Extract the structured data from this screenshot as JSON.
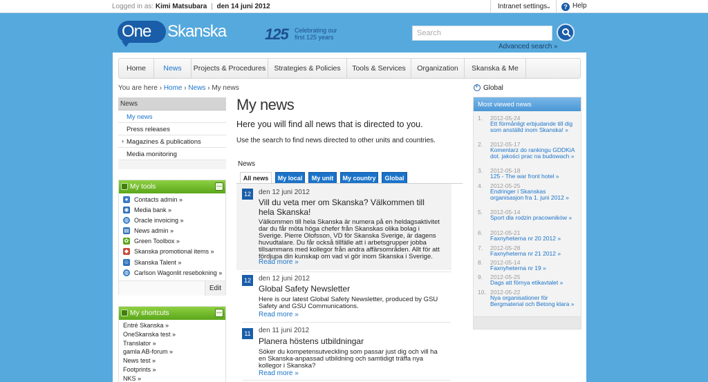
{
  "topbar": {
    "logged_in_label": "Logged in as:",
    "user": "Kimi Matsubara",
    "separator": "|",
    "date": "den 14 juni 2012",
    "intranet_settings": "Intranet settings",
    "help": "Help"
  },
  "header": {
    "logo_one": "One",
    "logo_skanska": "Skanska",
    "anniversary_number": "125",
    "anniversary_text": "Celebrating our first 125 years",
    "search_placeholder": "Search",
    "advanced_search": "Advanced search »"
  },
  "nav": {
    "items": [
      {
        "label": "Home"
      },
      {
        "label": "News"
      },
      {
        "label": "Projects & Procedures"
      },
      {
        "label": "Strategies & Policies"
      },
      {
        "label": "Tools & Services"
      },
      {
        "label": "Organization"
      },
      {
        "label": "Skanska & Me"
      }
    ],
    "active_index": 1
  },
  "breadcrumb": {
    "you_are_here": "You are here",
    "sep": "›",
    "home": "Home",
    "news": "News",
    "current": "My news"
  },
  "leftnav": {
    "header": "News",
    "items": [
      {
        "label": "My news"
      },
      {
        "label": "Press releases"
      },
      {
        "label": "Magazines & publications"
      },
      {
        "label": "Media monitoring"
      }
    ]
  },
  "mytools": {
    "title": "My tools",
    "items": [
      {
        "label": "Contacts admin »",
        "icon": "contacts-icon",
        "color": "#3a7bc8"
      },
      {
        "label": "Media bank »",
        "icon": "media-icon",
        "color": "#2d6db5"
      },
      {
        "label": "Oracle invoicing »",
        "icon": "globe-icon",
        "color": "#2f78c4"
      },
      {
        "label": "News admin »",
        "icon": "news-icon",
        "color": "#2b6fb8"
      },
      {
        "label": "Green Toolbox »",
        "icon": "leaf-icon",
        "color": "#5aa61b"
      },
      {
        "label": "Skanska promotional items »",
        "icon": "promo-icon",
        "color": "#c94a3a"
      },
      {
        "label": "Skanska Talent »",
        "icon": "people-icon",
        "color": "#2e72bd"
      },
      {
        "label": "Carlson Wagonlit resebokning »",
        "icon": "globe-icon",
        "color": "#2f78c4"
      }
    ],
    "edit": "Edit"
  },
  "myshortcuts": {
    "title": "My shortcuts",
    "items": [
      {
        "label": "Entré Skanska »"
      },
      {
        "label": "OneSkanska test »"
      },
      {
        "label": "Translator »"
      },
      {
        "label": "gamla AB-forum »"
      },
      {
        "label": "News test »"
      },
      {
        "label": "Footprints »"
      },
      {
        "label": "NKS »"
      }
    ]
  },
  "main": {
    "title": "My news",
    "lead": "Here you will find all news that is directed to you.",
    "sub": "Use the search to find news directed to other units and countries.",
    "news_label": "News",
    "tabs": [
      {
        "label": "All news"
      },
      {
        "label": "My local"
      },
      {
        "label": "My unit"
      },
      {
        "label": "My country"
      },
      {
        "label": "Global"
      }
    ],
    "articles": [
      {
        "day": "12",
        "date": "den 12 juni 2012",
        "title": "Vill du veta mer om Skanska? Välkommen till hela Skanska!",
        "body": "Välkommen till hela Skanska är numera på en heldagsaktivitet dar du får möta höga chefer från Skanskas olika bolag i Sverige. Pierre Olofsson, VD för Skanska Sverige, är dagens huvudtalare. Du får också tillfälle att i arbetsgrupper jobba tillsammans med kollegor från andra affärsområden. Allt för att fördjupa din kunskap om vad vi gör inom Skanska i Sverige.",
        "more": "Read more »"
      },
      {
        "day": "12",
        "date": "den 12 juni 2012",
        "title": "Global Safety Newsletter",
        "body": "Here is our latest Global Safety Newsletter, produced by GSU Safety and GSU Communications.",
        "more": "Read more »"
      },
      {
        "day": "11",
        "date": "den 11 juni 2012",
        "title": "Planera höstens utbildningar",
        "body": "Söker du kompetensutveckling som passar just dig och vill ha en Skanska-anpassad utbildning och samtidigt träffa nya kollegor i Skanska?",
        "more": "Read more »"
      }
    ]
  },
  "right": {
    "global": "Global",
    "most_viewed_title": "Most viewed news",
    "items": [
      {
        "n": "1.",
        "date": "2012-05-24",
        "title": "Ett förmånligt erbjudande till dig som anställd inom Skanska! »"
      },
      {
        "n": "2.",
        "date": "2012-05-17",
        "title": "Komentarz do rankingu GDDKiA dot. jakości prac na budowach »"
      },
      {
        "n": "3.",
        "date": "2012-05-18",
        "title": "125 - The war front hotel »"
      },
      {
        "n": "4.",
        "date": "2012-05-25",
        "title": "Endringer i Skanskas organisasjon fra 1. juni 2012 »"
      },
      {
        "n": "5.",
        "date": "2012-05-14",
        "title": "Sport dla rodzin pracowników »"
      },
      {
        "n": "6.",
        "date": "2012-05-21",
        "title": "Faxnyheterna nr 20 2012 »"
      },
      {
        "n": "7.",
        "date": "2012-05-28",
        "title": "Faxnyheterna nr 21 2012 »"
      },
      {
        "n": "8.",
        "date": "2012-05-14",
        "title": "Faxnyheterna nr 19 »"
      },
      {
        "n": "9.",
        "date": "2012-05-25",
        "title": "Dags att förnya etikavtalet »"
      },
      {
        "n": "10.",
        "date": "2012-05-22",
        "title": "Nya organisationer för Bergmaterial och Betong klara »"
      }
    ]
  },
  "colors": {
    "background": "#55a9dd",
    "brand_blue": "#1a5da8",
    "link": "#1a73c9",
    "widget_green": "#5aa61b"
  }
}
